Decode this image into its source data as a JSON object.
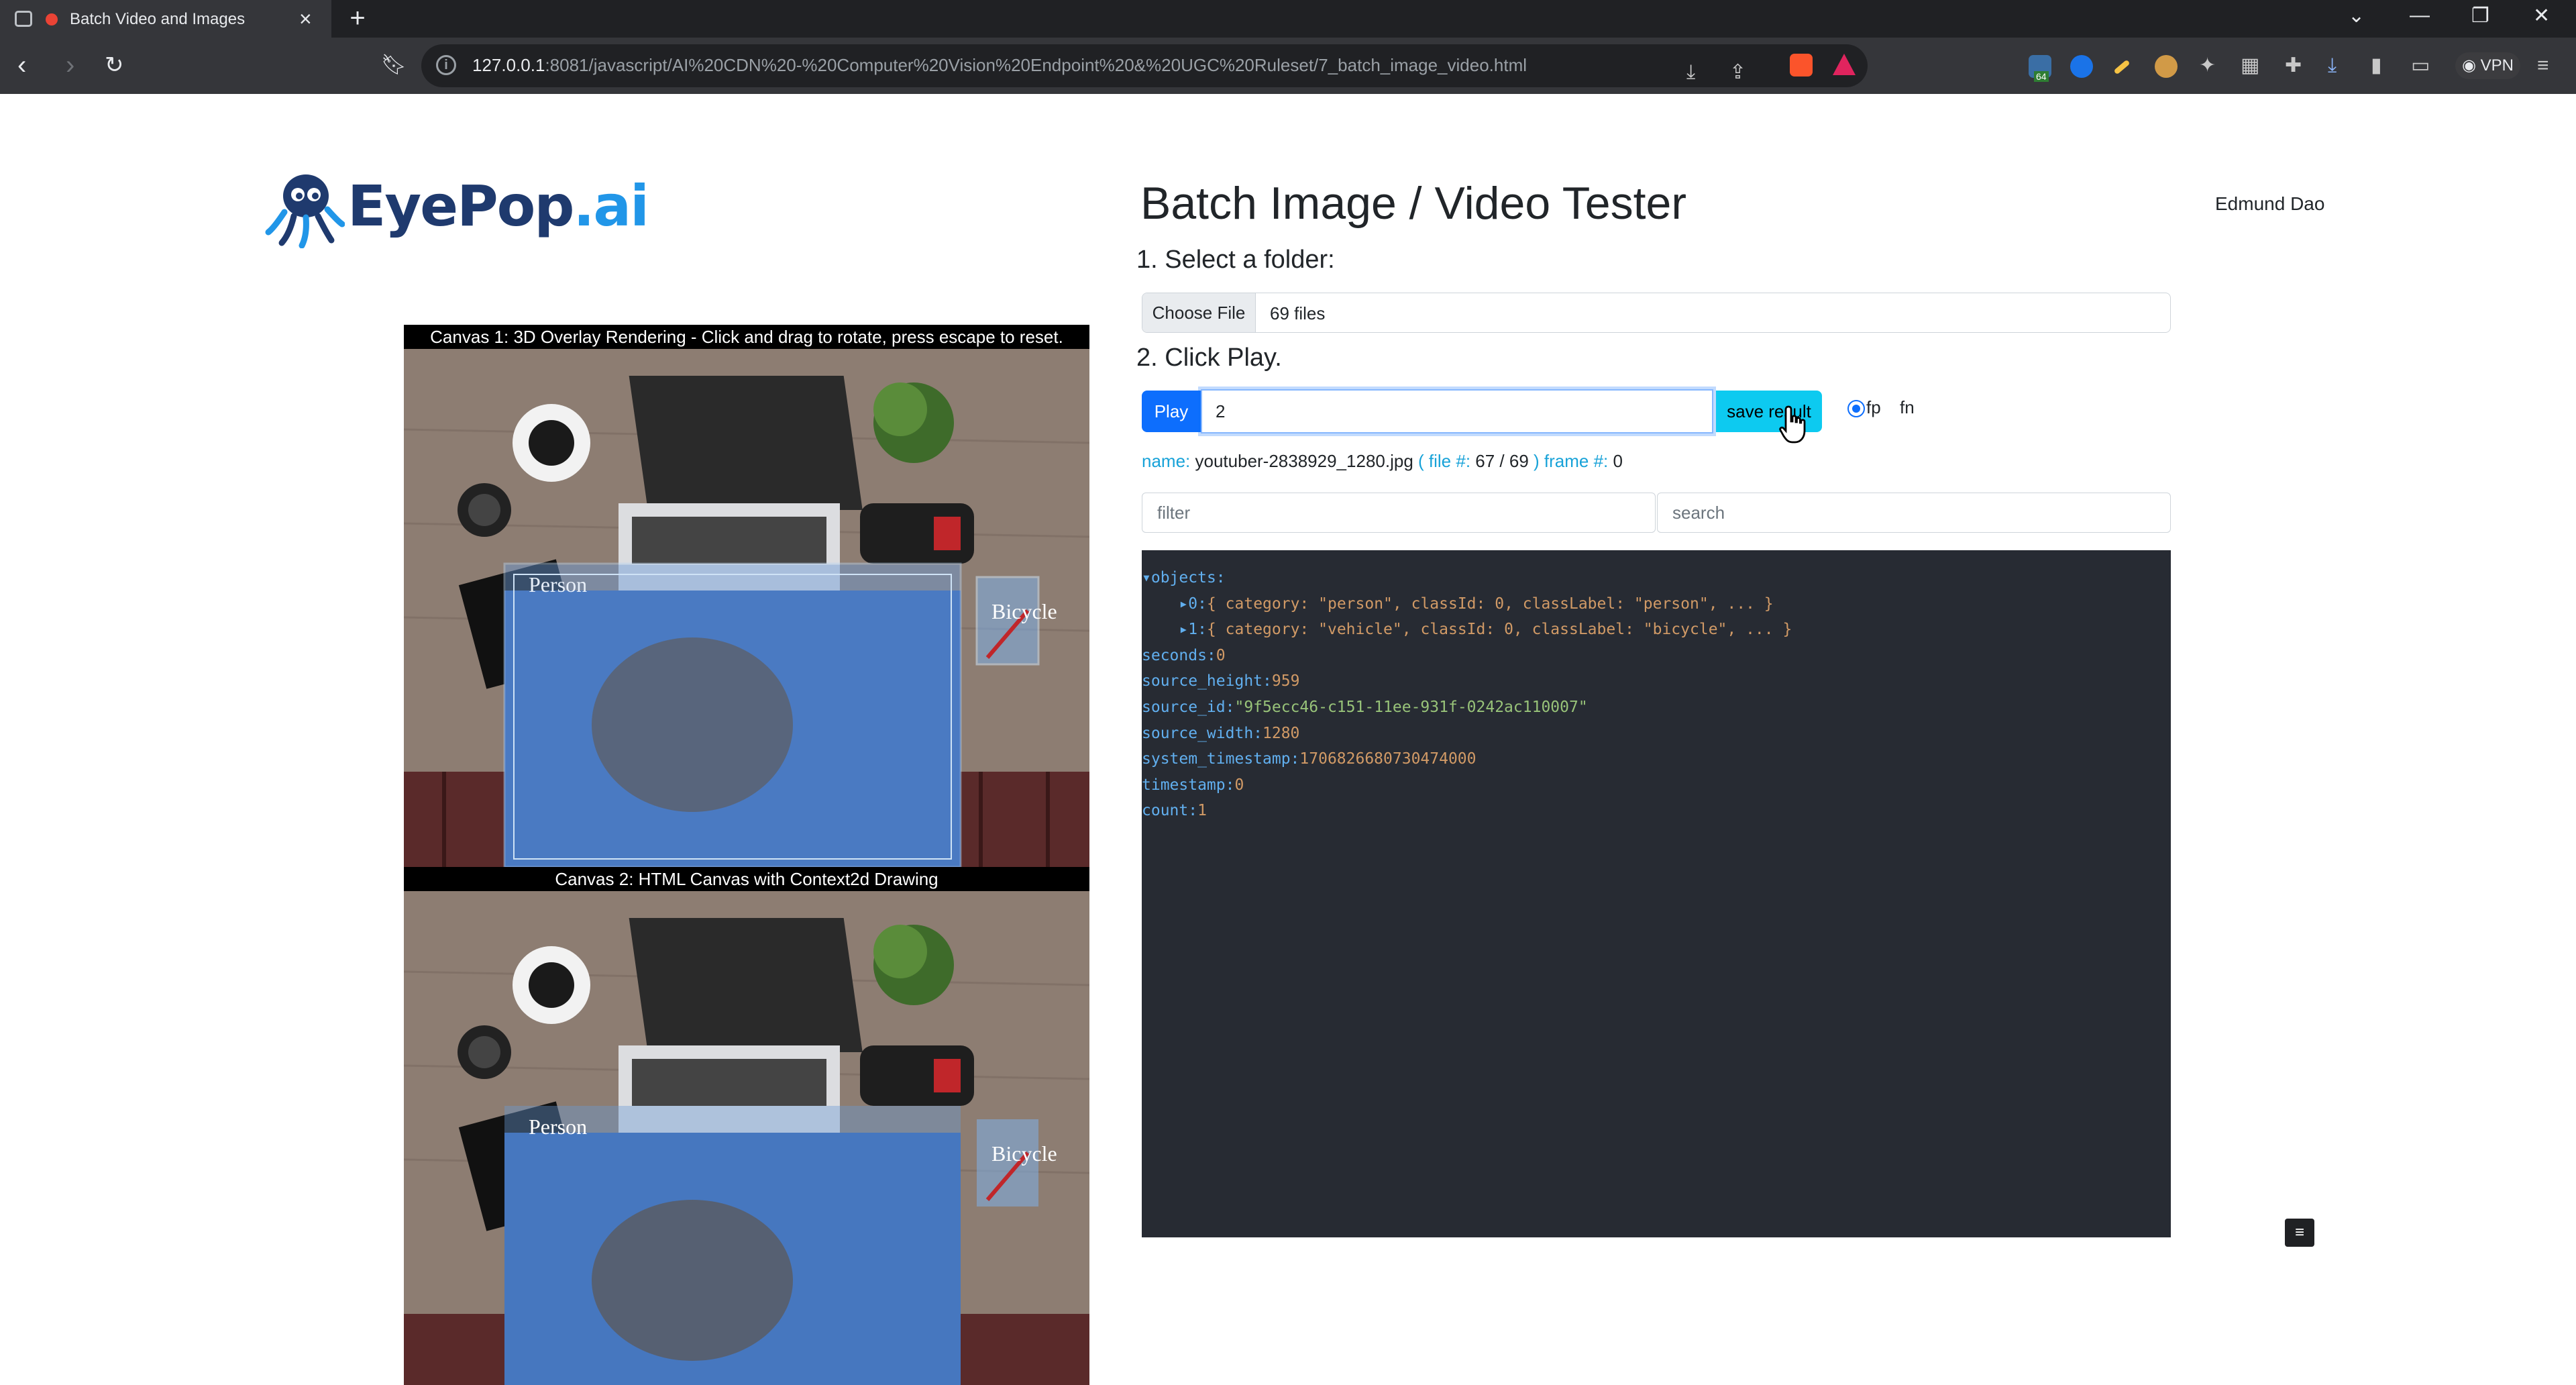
{
  "browser": {
    "tab_title": "Batch Video and Images",
    "url_host": "127.0.0.1",
    "url_path": ":8081/javascript/AI%20CDN%20-%20Computer%20Vision%20Endpoint%20&%20UGC%20Ruleset/7_batch_image_video.html",
    "vpn_label": "VPN",
    "ext_badge": "64"
  },
  "logo": {
    "part1": "EyePop",
    "part2": ".ai"
  },
  "header": {
    "title": "Batch Image / Video Tester",
    "user": "Edmund Dao"
  },
  "steps": {
    "step1": "1. Select a folder:",
    "choose_file": "Choose File",
    "file_count": "69 files",
    "step2": "2. Click Play.",
    "play": "Play",
    "frame_value": "2",
    "save": "save result",
    "fp": "fp",
    "fn": "fn"
  },
  "status": {
    "name_label": "name:",
    "name_value": "youtuber-2838929_1280.jpg",
    "file_label": "( file #:",
    "file_value": "67 / 69",
    "frame_label": ") frame #:",
    "frame_value": "0"
  },
  "filter": {
    "placeholder": "filter"
  },
  "search": {
    "placeholder": "search"
  },
  "json_view": {
    "objects_key": "objects:",
    "obj0_key": "0:",
    "obj0_summary": "{ category: \"person\", classId: 0, classLabel: \"person\", ... }",
    "obj1_key": "1:",
    "obj1_summary": "{ category: \"vehicle\", classId: 0, classLabel: \"bicycle\", ... }",
    "seconds_key": "seconds:",
    "seconds_val": "0",
    "source_height_key": "source_height:",
    "source_height_val": "959",
    "source_id_key": "source_id:",
    "source_id_val": "\"9f5ecc46-c151-11ee-931f-0242ac110007\"",
    "source_width_key": "source_width:",
    "source_width_val": "1280",
    "system_timestamp_key": "system_timestamp:",
    "system_timestamp_val": "1706826680730474000",
    "timestamp_key": "timestamp:",
    "timestamp_val": "0",
    "count_key": "count:",
    "count_val": "1"
  },
  "canvas1": {
    "label": "Canvas 1: 3D Overlay Rendering - Click and drag to rotate, press escape to reset.",
    "person": "Person",
    "bicycle": "Bicycle"
  },
  "canvas2": {
    "label": "Canvas 2: HTML Canvas with Context2d Drawing",
    "person": "Person",
    "bicycle": "Bicycle"
  },
  "mini_button": "≡"
}
